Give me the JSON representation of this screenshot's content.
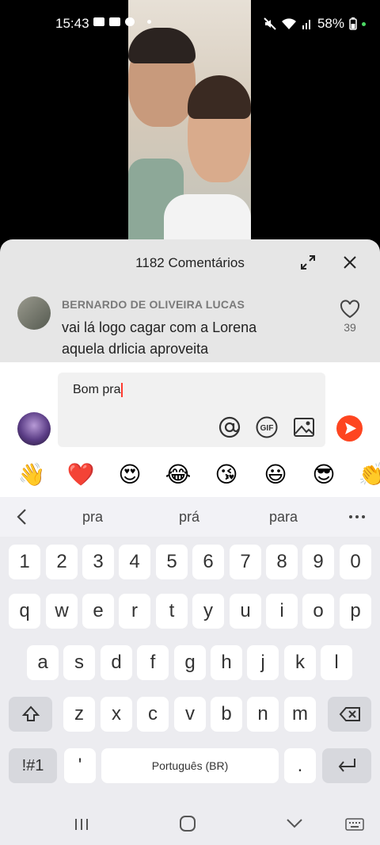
{
  "status_bar": {
    "time": "15:43",
    "battery": "58%",
    "icons": [
      "video-call-icon",
      "video-icon",
      "discord-icon",
      "dot-icon",
      "mute-icon",
      "wifi-icon",
      "signal-icon",
      "battery-icon"
    ]
  },
  "comments": {
    "title": "1182 Comentários",
    "items": [
      {
        "user": "BERNARDO DE OLIVEIRA LUCAS",
        "text": "vai lá logo cagar com a Lorena aquela drlicia aproveita",
        "likes": "39"
      }
    ]
  },
  "reply": {
    "text": "Bom pra",
    "tools": [
      "at-mention-icon",
      "gif-icon",
      "image-icon",
      "send-icon"
    ]
  },
  "emojis": [
    "👋",
    "❤️",
    "😍",
    "😂",
    "😘",
    "😃",
    "😎",
    "👏"
  ],
  "keyboard": {
    "suggestions": [
      "pra",
      "prá",
      "para"
    ],
    "row_numbers": [
      "1",
      "2",
      "3",
      "4",
      "5",
      "6",
      "7",
      "8",
      "9",
      "0"
    ],
    "row1": [
      "q",
      "w",
      "e",
      "r",
      "t",
      "y",
      "u",
      "i",
      "o",
      "p"
    ],
    "row2": [
      "a",
      "s",
      "d",
      "f",
      "g",
      "h",
      "j",
      "k",
      "l"
    ],
    "row3": [
      "z",
      "x",
      "c",
      "v",
      "b",
      "n",
      "m"
    ],
    "symbols_label": "!#1",
    "apostrophe": "'",
    "space_label": "Português (BR)",
    "period": "."
  },
  "colors": {
    "accent": "#fe4520",
    "heart": "#e02424"
  }
}
